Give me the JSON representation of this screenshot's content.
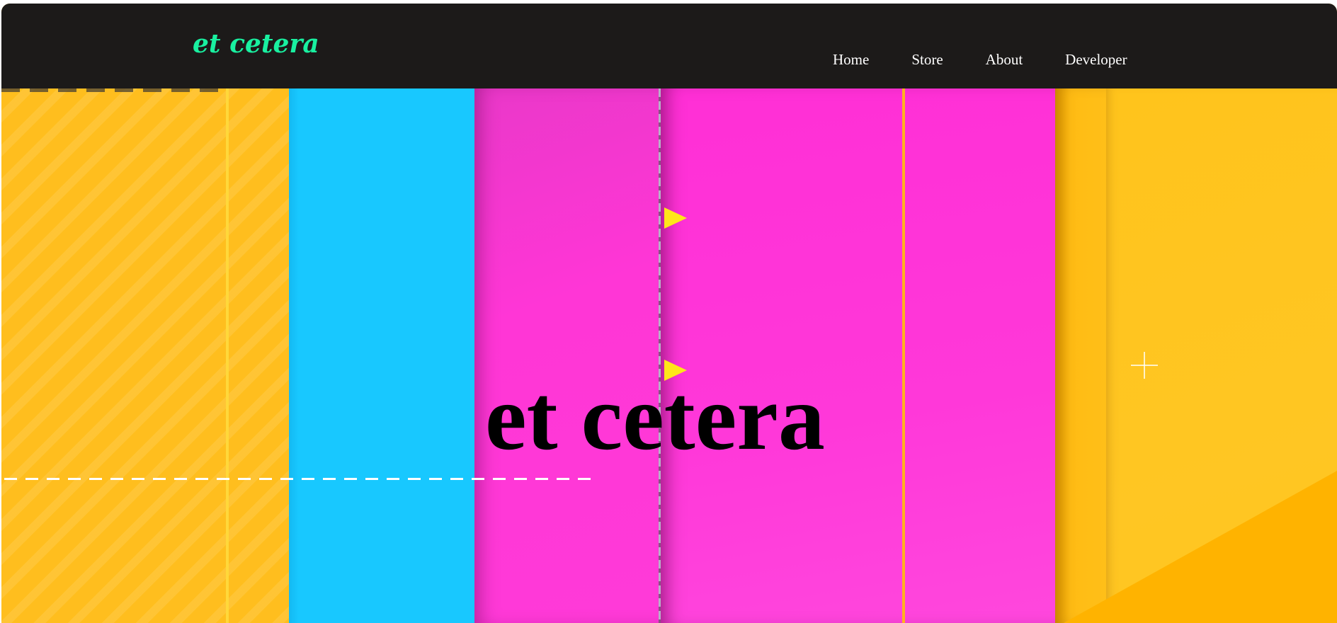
{
  "header": {
    "logo_text": "et cetera",
    "nav": [
      {
        "label": "Home"
      },
      {
        "label": "Store"
      },
      {
        "label": "About"
      },
      {
        "label": "Developer"
      }
    ]
  },
  "hero": {
    "title": "et cetera"
  },
  "colors": {
    "header_background": "#1c1a19",
    "logo": "#19f0a0",
    "nav_text": "#ffffff",
    "band_yellow": "#ffbe1e",
    "band_cyan": "#18c8ff",
    "band_magenta": "#ff36d6",
    "play_marker": "#ffe61a",
    "hero_title": "#000000"
  },
  "icons": {
    "play_markers": "play-triangle-icon",
    "plus_mark": "plus-icon"
  }
}
